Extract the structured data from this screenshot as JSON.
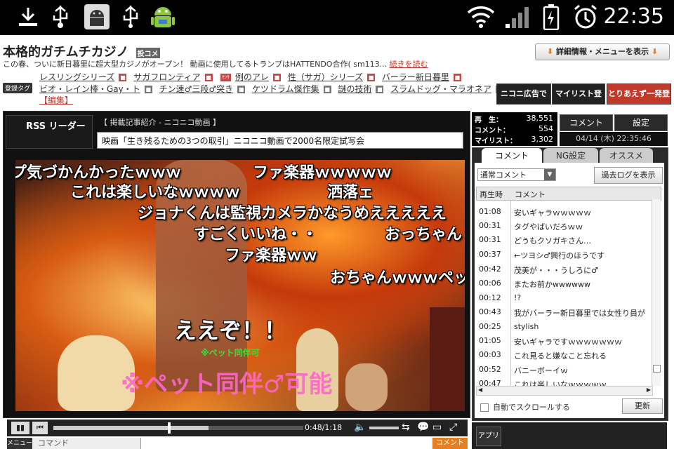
{
  "statusbar": {
    "clock": "22:35"
  },
  "header": {
    "title": "本格的ガチムチカジノ",
    "title_badge": "投コメ",
    "description": "この春、ついに新日暮里に超大型カジノがオープン！ 動画に使用してるトランプはHATTENDO合作( sm113...",
    "read_more": "続きを読む",
    "detail_button": "詳細情報・メニューを表示",
    "tag_label": "登録タグ",
    "tags_row1": [
      "レスリングシリーズ",
      "サガフロンティア",
      "例のアレ",
      "性（サガ）シリーズ",
      "バーラー新日暮里"
    ],
    "tags_row1_badge": "ｾﾝｻ",
    "tags_row2": [
      "ビオ・レイン棒・Gay・ト",
      "チン速♂三段♂突き",
      "ケツドラム傑作集",
      "謎の技術",
      "スラムドッグ・マラオネア"
    ],
    "edit_link": "【編集】"
  },
  "ads": {
    "nico_ad": "ニコニ広告で宣伝",
    "mylist": "マイリスト登録",
    "quick_register": "とりあえず一発登録"
  },
  "player": {
    "rss_logo": "RSS リーダー",
    "news_header": "【 掲載記事紹介 - ニコニコ動画 】",
    "news_text": "映画「生き残るための3つの取引」ニコニコ動画で2000名限定試写会",
    "time": "0:48/1:18",
    "progress": 0.62,
    "menu_label": "メニュー",
    "command_placeholder": "コマンド",
    "comment_button": "コメント"
  },
  "danmaku": [
    "プ気づかんかったｗｗｗ",
    "ファ楽器ｗｗｗｗｗ",
    "これは楽しいなｗｗｗｗ",
    "洒落ェ",
    "ジョナくんは監視カメラかなうめえええええ",
    "すごくいいね・・",
    "おっちゃん",
    "ファ楽器ｗｗ",
    "おちゃんｗｗｗペット",
    "ええぞ！！",
    "※ペット同伴可",
    "※ペット同伴♂可能"
  ],
  "stats": {
    "play_label": "再　生：",
    "play_count": "38,551",
    "comment_label": "コメント：",
    "comment_count": "554",
    "mylist_label": "マイリスト：",
    "mylist_count": "3,302",
    "datetime": "04/14 (木) 22:35:46"
  },
  "right_panel": {
    "btn_comment": "コメント",
    "btn_settings": "設定",
    "tabs": [
      "コメント",
      "NG設定",
      "オススメ"
    ],
    "mode": "通常コメント",
    "past_log": "過去ログを表示",
    "col_time": "再生時",
    "col_comment": "コメント",
    "auto_scroll": "自動でスクロールする",
    "refresh": "更新",
    "app": "アプリ"
  },
  "comments": [
    {
      "t": "01:08",
      "c": "安いギャラｗｗｗｗｗ"
    },
    {
      "t": "00:31",
      "c": "タグやばいだろｗｗ"
    },
    {
      "t": "00:31",
      "c": "どうもクソガキさん…"
    },
    {
      "t": "00:37",
      "c": "←ツヨシ♂興行のほうです"
    },
    {
      "t": "00:42",
      "c": "茂美が・・・うしろに♂"
    },
    {
      "t": "00:06",
      "c": "またお前かwwwwww"
    },
    {
      "t": "00:12",
      "c": "!?"
    },
    {
      "t": "00:43",
      "c": "我がバーラー新日暮里では女性り員が"
    },
    {
      "t": "00:25",
      "c": "stylish"
    },
    {
      "t": "01:05",
      "c": "安いギャラですｗｗｗｗｗｗｗ"
    },
    {
      "t": "00:03",
      "c": "これ見ると嫌なこと忘れる"
    },
    {
      "t": "00:52",
      "c": "バニーボーイｗ"
    },
    {
      "t": "00:47",
      "c": "これは楽しいなｗｗｗｗｗ"
    }
  ]
}
